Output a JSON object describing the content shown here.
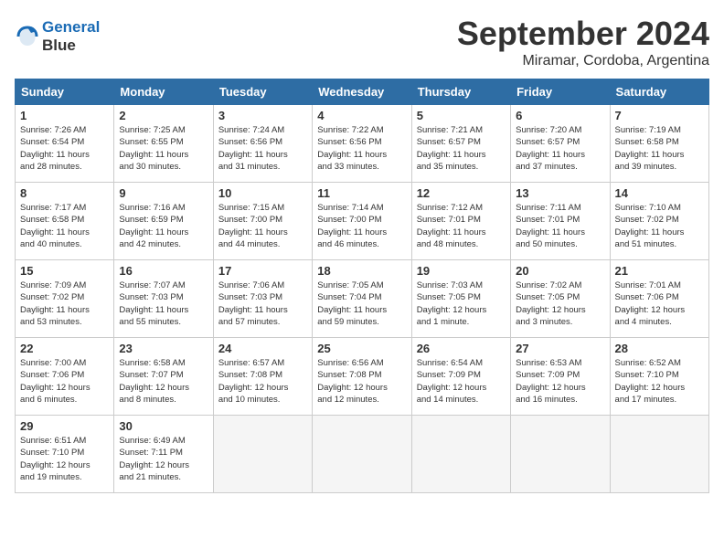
{
  "header": {
    "logo_line1": "General",
    "logo_line2": "Blue",
    "title": "September 2024",
    "subtitle": "Miramar, Cordoba, Argentina"
  },
  "columns": [
    "Sunday",
    "Monday",
    "Tuesday",
    "Wednesday",
    "Thursday",
    "Friday",
    "Saturday"
  ],
  "weeks": [
    [
      {
        "day": "1",
        "info": "Sunrise: 7:26 AM\nSunset: 6:54 PM\nDaylight: 11 hours\nand 28 minutes."
      },
      {
        "day": "2",
        "info": "Sunrise: 7:25 AM\nSunset: 6:55 PM\nDaylight: 11 hours\nand 30 minutes."
      },
      {
        "day": "3",
        "info": "Sunrise: 7:24 AM\nSunset: 6:56 PM\nDaylight: 11 hours\nand 31 minutes."
      },
      {
        "day": "4",
        "info": "Sunrise: 7:22 AM\nSunset: 6:56 PM\nDaylight: 11 hours\nand 33 minutes."
      },
      {
        "day": "5",
        "info": "Sunrise: 7:21 AM\nSunset: 6:57 PM\nDaylight: 11 hours\nand 35 minutes."
      },
      {
        "day": "6",
        "info": "Sunrise: 7:20 AM\nSunset: 6:57 PM\nDaylight: 11 hours\nand 37 minutes."
      },
      {
        "day": "7",
        "info": "Sunrise: 7:19 AM\nSunset: 6:58 PM\nDaylight: 11 hours\nand 39 minutes."
      }
    ],
    [
      {
        "day": "8",
        "info": "Sunrise: 7:17 AM\nSunset: 6:58 PM\nDaylight: 11 hours\nand 40 minutes."
      },
      {
        "day": "9",
        "info": "Sunrise: 7:16 AM\nSunset: 6:59 PM\nDaylight: 11 hours\nand 42 minutes."
      },
      {
        "day": "10",
        "info": "Sunrise: 7:15 AM\nSunset: 7:00 PM\nDaylight: 11 hours\nand 44 minutes."
      },
      {
        "day": "11",
        "info": "Sunrise: 7:14 AM\nSunset: 7:00 PM\nDaylight: 11 hours\nand 46 minutes."
      },
      {
        "day": "12",
        "info": "Sunrise: 7:12 AM\nSunset: 7:01 PM\nDaylight: 11 hours\nand 48 minutes."
      },
      {
        "day": "13",
        "info": "Sunrise: 7:11 AM\nSunset: 7:01 PM\nDaylight: 11 hours\nand 50 minutes."
      },
      {
        "day": "14",
        "info": "Sunrise: 7:10 AM\nSunset: 7:02 PM\nDaylight: 11 hours\nand 51 minutes."
      }
    ],
    [
      {
        "day": "15",
        "info": "Sunrise: 7:09 AM\nSunset: 7:02 PM\nDaylight: 11 hours\nand 53 minutes."
      },
      {
        "day": "16",
        "info": "Sunrise: 7:07 AM\nSunset: 7:03 PM\nDaylight: 11 hours\nand 55 minutes."
      },
      {
        "day": "17",
        "info": "Sunrise: 7:06 AM\nSunset: 7:03 PM\nDaylight: 11 hours\nand 57 minutes."
      },
      {
        "day": "18",
        "info": "Sunrise: 7:05 AM\nSunset: 7:04 PM\nDaylight: 11 hours\nand 59 minutes."
      },
      {
        "day": "19",
        "info": "Sunrise: 7:03 AM\nSunset: 7:05 PM\nDaylight: 12 hours\nand 1 minute."
      },
      {
        "day": "20",
        "info": "Sunrise: 7:02 AM\nSunset: 7:05 PM\nDaylight: 12 hours\nand 3 minutes."
      },
      {
        "day": "21",
        "info": "Sunrise: 7:01 AM\nSunset: 7:06 PM\nDaylight: 12 hours\nand 4 minutes."
      }
    ],
    [
      {
        "day": "22",
        "info": "Sunrise: 7:00 AM\nSunset: 7:06 PM\nDaylight: 12 hours\nand 6 minutes."
      },
      {
        "day": "23",
        "info": "Sunrise: 6:58 AM\nSunset: 7:07 PM\nDaylight: 12 hours\nand 8 minutes."
      },
      {
        "day": "24",
        "info": "Sunrise: 6:57 AM\nSunset: 7:08 PM\nDaylight: 12 hours\nand 10 minutes."
      },
      {
        "day": "25",
        "info": "Sunrise: 6:56 AM\nSunset: 7:08 PM\nDaylight: 12 hours\nand 12 minutes."
      },
      {
        "day": "26",
        "info": "Sunrise: 6:54 AM\nSunset: 7:09 PM\nDaylight: 12 hours\nand 14 minutes."
      },
      {
        "day": "27",
        "info": "Sunrise: 6:53 AM\nSunset: 7:09 PM\nDaylight: 12 hours\nand 16 minutes."
      },
      {
        "day": "28",
        "info": "Sunrise: 6:52 AM\nSunset: 7:10 PM\nDaylight: 12 hours\nand 17 minutes."
      }
    ],
    [
      {
        "day": "29",
        "info": "Sunrise: 6:51 AM\nSunset: 7:10 PM\nDaylight: 12 hours\nand 19 minutes."
      },
      {
        "day": "30",
        "info": "Sunrise: 6:49 AM\nSunset: 7:11 PM\nDaylight: 12 hours\nand 21 minutes."
      },
      {
        "day": "",
        "info": ""
      },
      {
        "day": "",
        "info": ""
      },
      {
        "day": "",
        "info": ""
      },
      {
        "day": "",
        "info": ""
      },
      {
        "day": "",
        "info": ""
      }
    ]
  ]
}
